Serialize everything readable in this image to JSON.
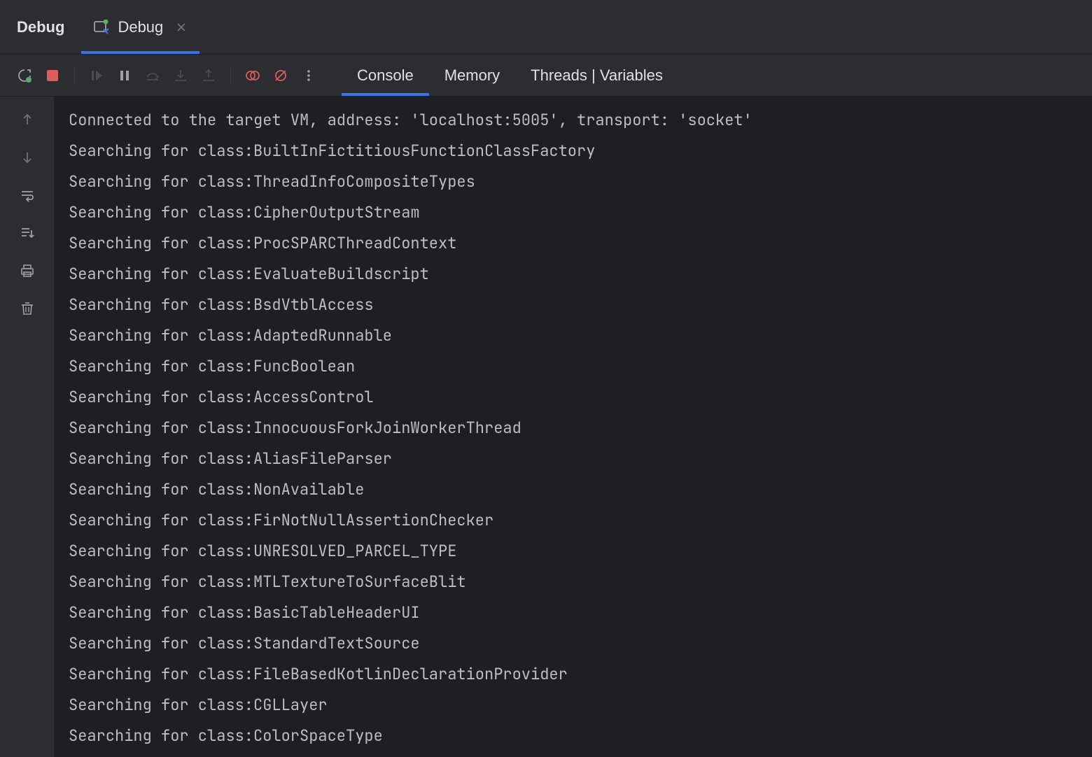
{
  "header": {
    "title": "Debug",
    "tab_label": "Debug"
  },
  "subtabs": {
    "console": "Console",
    "memory": "Memory",
    "threads": "Threads | Variables"
  },
  "console_lines": [
    "Connected to the target VM, address: 'localhost:5005', transport: 'socket'",
    "Searching for class:BuiltInFictitiousFunctionClassFactory",
    "Searching for class:ThreadInfoCompositeTypes",
    "Searching for class:CipherOutputStream",
    "Searching for class:ProcSPARCThreadContext",
    "Searching for class:EvaluateBuildscript",
    "Searching for class:BsdVtblAccess",
    "Searching for class:AdaptedRunnable",
    "Searching for class:FuncBoolean",
    "Searching for class:AccessControl",
    "Searching for class:InnocuousForkJoinWorkerThread",
    "Searching for class:AliasFileParser",
    "Searching for class:NonAvailable",
    "Searching for class:FirNotNullAssertionChecker",
    "Searching for class:UNRESOLVED_PARCEL_TYPE",
    "Searching for class:MTLTextureToSurfaceBlit",
    "Searching for class:BasicTableHeaderUI",
    "Searching for class:StandardTextSource",
    "Searching for class:FileBasedKotlinDeclarationProvider",
    "Searching for class:CGLLayer",
    "Searching for class:ColorSpaceType"
  ]
}
